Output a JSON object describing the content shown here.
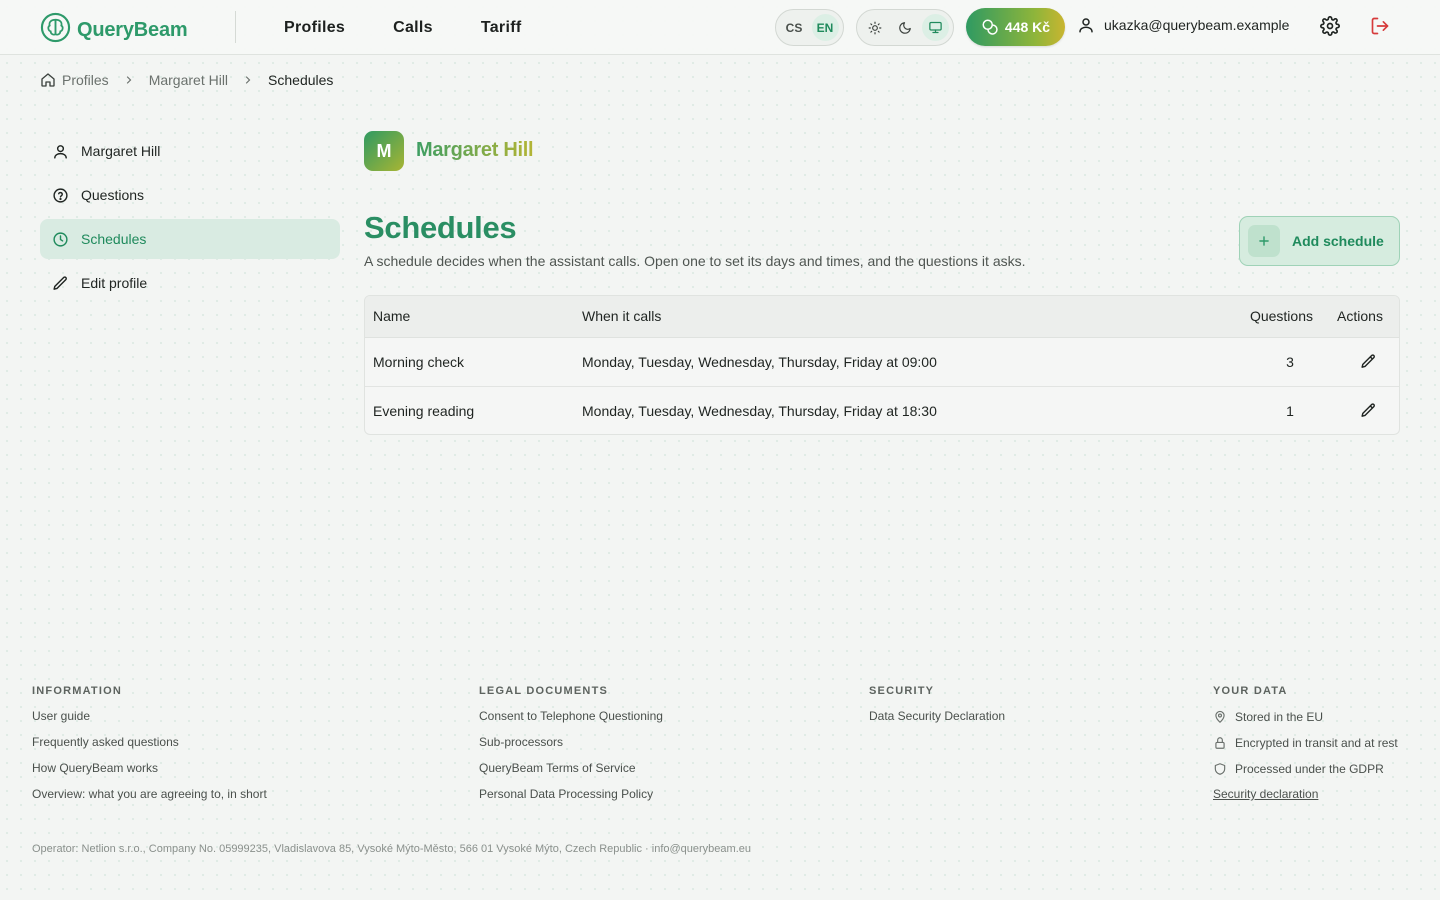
{
  "app": {
    "brand": "QueryBeam",
    "accent_color": "#2e9a6a"
  },
  "nav": {
    "items": [
      "Profiles",
      "Calls",
      "Tariff"
    ]
  },
  "header": {
    "languages": [
      "CS",
      "EN"
    ],
    "active_language": "EN",
    "theme_options": [
      "sun-icon",
      "moon-icon",
      "monitor-icon"
    ],
    "active_theme": "monitor-icon",
    "credit": "448 Kč",
    "user_email": "ukazka@querybeam.example"
  },
  "breadcrumb": {
    "items": [
      "Profiles",
      "Margaret Hill",
      "Schedules"
    ]
  },
  "sidebar": {
    "items": [
      {
        "label": "Margaret Hill",
        "icon": "user-icon"
      },
      {
        "label": "Questions",
        "icon": "question-circle-icon"
      },
      {
        "label": "Schedules",
        "icon": "clock-icon",
        "active": true
      },
      {
        "label": "Edit profile",
        "icon": "pencil-icon"
      }
    ]
  },
  "profile": {
    "initial": "M",
    "name": "Margaret Hill"
  },
  "main": {
    "title": "Schedules",
    "subtitle": "A schedule decides when the assistant calls. Open one to set its days and times, and the questions it asks.",
    "add_button": "Add schedule"
  },
  "table": {
    "headers": [
      "Name",
      "When it calls",
      "Questions",
      "Actions"
    ],
    "rows": [
      {
        "name": "Morning check",
        "when": "Monday, Tuesday, Wednesday, Thursday, Friday at 09:00",
        "questions": "3"
      },
      {
        "name": "Evening reading",
        "when": "Monday, Tuesday, Wednesday, Thursday, Friday at 18:30",
        "questions": "1"
      }
    ]
  },
  "footer": {
    "information": {
      "heading": "INFORMATION",
      "links": [
        "User guide",
        "Frequently asked questions",
        "How QueryBeam works",
        "Overview: what you are agreeing to, in short"
      ]
    },
    "legal": {
      "heading": "LEGAL DOCUMENTS",
      "links": [
        "Consent to Telephone Questioning",
        "Sub-processors",
        "QueryBeam Terms of Service",
        "Personal Data Processing Policy"
      ]
    },
    "security": {
      "heading": "SECURITY",
      "links": [
        "Data Security Declaration"
      ]
    },
    "your_data": {
      "heading": "YOUR DATA",
      "items": [
        "Stored in the EU",
        "Encrypted in transit and at rest",
        "Processed under the GDPR"
      ],
      "link": "Security declaration"
    },
    "operator": "Operator: Netlion s.r.o., Company No. 05999235, Vladislavova 85, Vysoké Mýto-Město, 566 01 Vysoké Mýto, Czech Republic · info@querybeam.eu"
  }
}
